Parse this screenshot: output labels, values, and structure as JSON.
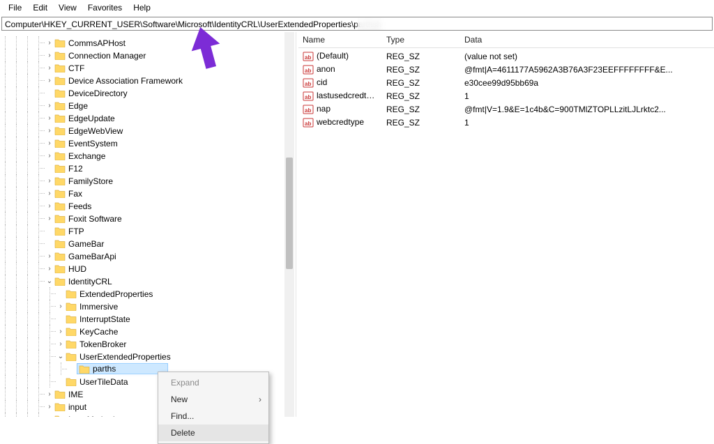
{
  "menubar": [
    "File",
    "Edit",
    "View",
    "Favorites",
    "Help"
  ],
  "address": "Computer\\HKEY_CURRENT_USER\\Software\\Microsoft\\IdentityCRL\\UserExtendedProperties\\parthsh",
  "tree": [
    {
      "depth": 4,
      "expander": ">",
      "label": "CommsAPHost"
    },
    {
      "depth": 4,
      "expander": ">",
      "label": "Connection Manager"
    },
    {
      "depth": 4,
      "expander": ">",
      "label": "CTF"
    },
    {
      "depth": 4,
      "expander": ">",
      "label": "Device Association Framework"
    },
    {
      "depth": 4,
      "expander": "",
      "label": "DeviceDirectory"
    },
    {
      "depth": 4,
      "expander": ">",
      "label": "Edge"
    },
    {
      "depth": 4,
      "expander": ">",
      "label": "EdgeUpdate"
    },
    {
      "depth": 4,
      "expander": ">",
      "label": "EdgeWebView"
    },
    {
      "depth": 4,
      "expander": ">",
      "label": "EventSystem"
    },
    {
      "depth": 4,
      "expander": ">",
      "label": "Exchange"
    },
    {
      "depth": 4,
      "expander": "",
      "label": "F12"
    },
    {
      "depth": 4,
      "expander": ">",
      "label": "FamilyStore"
    },
    {
      "depth": 4,
      "expander": ">",
      "label": "Fax"
    },
    {
      "depth": 4,
      "expander": ">",
      "label": "Feeds"
    },
    {
      "depth": 4,
      "expander": ">",
      "label": "Foxit Software"
    },
    {
      "depth": 4,
      "expander": "",
      "label": "FTP"
    },
    {
      "depth": 4,
      "expander": "",
      "label": "GameBar"
    },
    {
      "depth": 4,
      "expander": ">",
      "label": "GameBarApi"
    },
    {
      "depth": 4,
      "expander": ">",
      "label": "HUD"
    },
    {
      "depth": 4,
      "expander": "v",
      "label": "IdentityCRL"
    },
    {
      "depth": 5,
      "expander": "",
      "label": "ExtendedProperties"
    },
    {
      "depth": 5,
      "expander": ">",
      "label": "Immersive"
    },
    {
      "depth": 5,
      "expander": "",
      "label": "InterruptState"
    },
    {
      "depth": 5,
      "expander": ">",
      "label": "KeyCache"
    },
    {
      "depth": 5,
      "expander": ">",
      "label": "TokenBroker"
    },
    {
      "depth": 5,
      "expander": "v",
      "label": "UserExtendedProperties"
    },
    {
      "depth": 6,
      "expander": "",
      "label": "parths",
      "selected": true,
      "blur": true
    },
    {
      "depth": 5,
      "expander": "",
      "label": "UserTileData"
    },
    {
      "depth": 4,
      "expander": ">",
      "label": "IME"
    },
    {
      "depth": 4,
      "expander": ">",
      "label": "input"
    },
    {
      "depth": 4,
      "expander": ">",
      "label": "InputMethod"
    }
  ],
  "columns": {
    "name": "Name",
    "type": "Type",
    "data": "Data"
  },
  "values": [
    {
      "name": "(Default)",
      "type": "REG_SZ",
      "data": "(value not set)"
    },
    {
      "name": "anon",
      "type": "REG_SZ",
      "data": "@fmt|A=4611177A5962A3B76A3F23EEFFFFFFFF&E..."
    },
    {
      "name": "cid",
      "type": "REG_SZ",
      "data": "e30cee99d95bb69a"
    },
    {
      "name": "lastusedcredtype",
      "type": "REG_SZ",
      "data": "1"
    },
    {
      "name": "nap",
      "type": "REG_SZ",
      "data": "@fmt|V=1.9&E=1c4b&C=900TMlZTOPLLzitLJLrktc2..."
    },
    {
      "name": "webcredtype",
      "type": "REG_SZ",
      "data": "1"
    }
  ],
  "context_menu": [
    {
      "label": "Expand",
      "disabled": true
    },
    {
      "label": "New",
      "submenu": true
    },
    {
      "label": "Find..."
    },
    {
      "label": "Delete",
      "hover": true
    }
  ],
  "annotation_color": "#7c2cd6"
}
